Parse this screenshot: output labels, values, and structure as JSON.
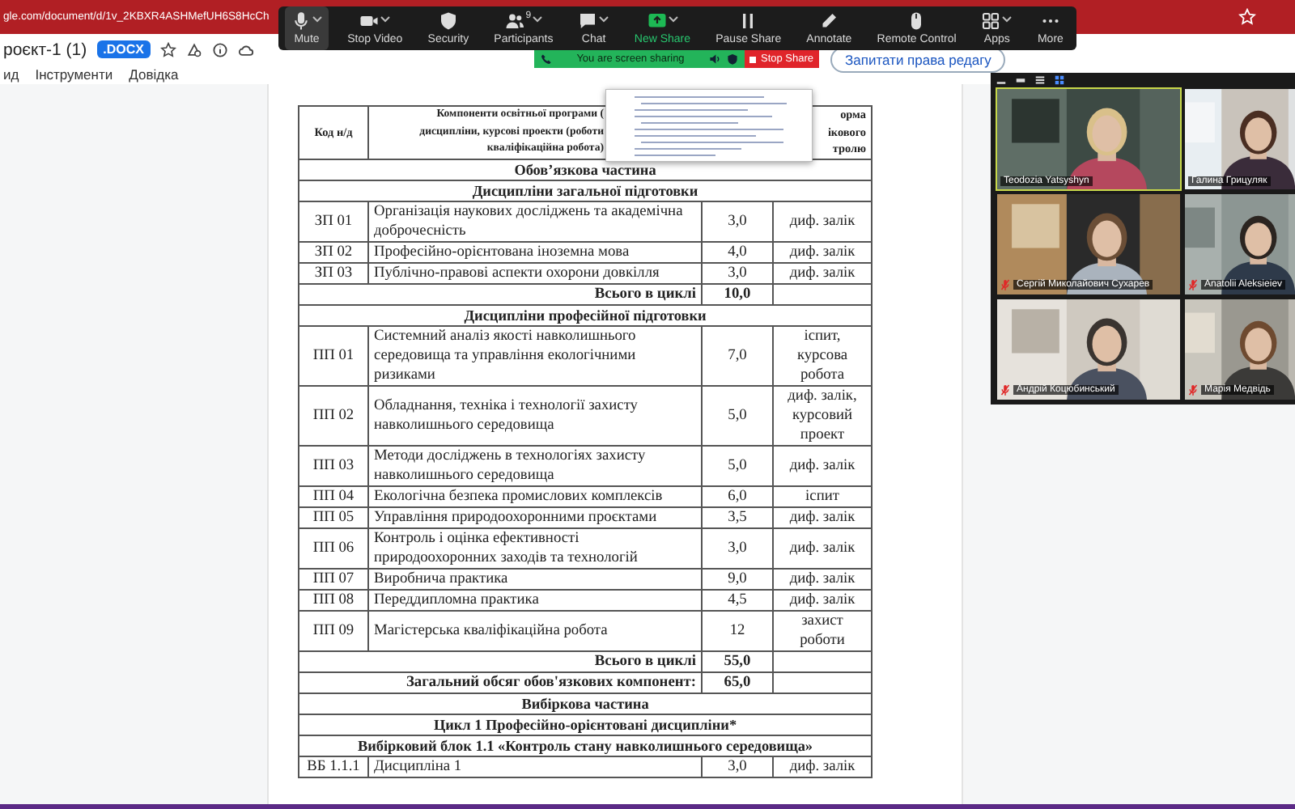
{
  "browser": {
    "url": "gle.com/document/d/1v_2KBXR4ASHMefUH6S8HcCh"
  },
  "document": {
    "title": "роєкт-1 (1)",
    "badge": ".DOCX",
    "menu": [
      "ид",
      "Інструменти",
      "Довідка"
    ],
    "request_button": "Запитати права редагу"
  },
  "meeting_toolbar": {
    "items": [
      {
        "label": "Mute",
        "kind": "mic",
        "caret": true,
        "selected": true,
        "accent": false
      },
      {
        "label": "Stop Video",
        "kind": "camera",
        "caret": true,
        "selected": false,
        "accent": false
      },
      {
        "label": "Security",
        "kind": "shield",
        "caret": false,
        "selected": false,
        "accent": false
      },
      {
        "label": "Participants",
        "kind": "people",
        "caret": true,
        "selected": false,
        "accent": false,
        "count": "9"
      },
      {
        "label": "Chat",
        "kind": "chat",
        "caret": true,
        "selected": false,
        "accent": false
      },
      {
        "label": "New Share",
        "kind": "share",
        "caret": true,
        "selected": false,
        "accent": true
      },
      {
        "label": "Pause Share",
        "kind": "pause",
        "caret": false,
        "selected": false,
        "accent": false
      },
      {
        "label": "Annotate",
        "kind": "pen",
        "caret": false,
        "selected": false,
        "accent": false
      },
      {
        "label": "Remote Control",
        "kind": "mouse",
        "caret": false,
        "selected": false,
        "accent": false
      },
      {
        "label": "Apps",
        "kind": "apps",
        "caret": true,
        "selected": false,
        "accent": false
      },
      {
        "label": "More",
        "kind": "more",
        "caret": false,
        "selected": false,
        "accent": false
      }
    ]
  },
  "sharing_bar": {
    "status": "You are screen sharing",
    "stop_label": "Stop Share"
  },
  "table": {
    "header": {
      "code": "Код н/д",
      "components": [
        "Компоненти освітньої програми (",
        "дисципліни, курсові проекти (роботи",
        "кваліфікаційна робота)"
      ],
      "control": [
        "орма",
        "ікового",
        "тролю"
      ]
    },
    "rows": [
      {
        "kind": "section",
        "text": "Обов’язкова частина"
      },
      {
        "kind": "section",
        "text": "Дисципліни загальної підготовки"
      },
      {
        "kind": "item",
        "code": "ЗП 01",
        "name": "Організація наукових досліджень та академічна доброчесність",
        "credits": "3,0",
        "control": "диф. залік"
      },
      {
        "kind": "item",
        "code": "ЗП 02",
        "name": "Професійно-орієнтована іноземна мова",
        "credits": "4,0",
        "control": "диф. залік"
      },
      {
        "kind": "item",
        "code": "ЗП 03",
        "name": "Публічно-правові аспекти охорони довкілля",
        "credits": "3,0",
        "control": "диф. залік"
      },
      {
        "kind": "total",
        "text": "Всього в циклі",
        "value": "10,0"
      },
      {
        "kind": "section",
        "text": "Дисципліни професійної підготовки"
      },
      {
        "kind": "item",
        "code": "ПП 01",
        "name": "Системний аналіз якості навколишнього середовища та управління екологічними ризиками",
        "credits": "7,0",
        "control": "іспит, курсова робота"
      },
      {
        "kind": "item",
        "code": "ПП 02",
        "name": "Обладнання, техніка і технології захисту навколишнього середовища",
        "credits": "5,0",
        "control": "диф. залік, курсовий проект"
      },
      {
        "kind": "item",
        "code": "ПП 03",
        "name": "Методи досліджень в технологіях захисту навколишнього середовища",
        "credits": "5,0",
        "control": "диф. залік"
      },
      {
        "kind": "item",
        "code": "ПП 04",
        "name": "Екологічна безпека промислових комплексів",
        "credits": "6,0",
        "control": "іспит"
      },
      {
        "kind": "item",
        "code": "ПП 05",
        "name": "Управління природоохоронними проєктами",
        "credits": "3,5",
        "control": "диф. залік"
      },
      {
        "kind": "item",
        "code": "ПП 06",
        "name": "Контроль і оцінка ефективності природоохоронних заходів та технологій",
        "credits": "3,0",
        "control": "диф. залік"
      },
      {
        "kind": "item",
        "code": "ПП 07",
        "name": "Виробнича практика",
        "credits": "9,0",
        "control": "диф. залік"
      },
      {
        "kind": "item",
        "code": "ПП 08",
        "name": "Переддипломна практика",
        "credits": "4,5",
        "control": "диф. залік"
      },
      {
        "kind": "item",
        "code": "ПП 09",
        "name": "Магістерська кваліфікаційна робота",
        "credits": "12",
        "control": "захист роботи"
      },
      {
        "kind": "total",
        "text": "Всього в циклі",
        "value": "55,0"
      },
      {
        "kind": "total",
        "text": "Загальний обсяг обов'язкових компонент:",
        "value": "65,0"
      },
      {
        "kind": "section",
        "text": "Вибіркова частина"
      },
      {
        "kind": "section",
        "text": "Цикл 1 Професійно-орієнтовані дисципліни*"
      },
      {
        "kind": "section",
        "text": "Вибірковий блок 1.1 «Контроль стану навколишнього середовища»"
      },
      {
        "kind": "item",
        "code": "ВБ 1.1.1",
        "name": "Дисципліна 1",
        "credits": "3,0",
        "control": "диф. залік"
      }
    ]
  },
  "video_panel": {
    "tiles": [
      {
        "name": "Teodozia Yatsyshyn",
        "muted": false,
        "speaking": true
      },
      {
        "name": "Галина Грицуляк",
        "muted": false,
        "speaking": false
      },
      {
        "name": "Сергій Миколайович Сухарев",
        "muted": true,
        "speaking": false
      },
      {
        "name": "Anatolii Aleksieiev",
        "muted": true,
        "speaking": false
      },
      {
        "name": "Андрій Коцюбинський",
        "muted": true,
        "speaking": false
      },
      {
        "name": "Марія Медвідь",
        "muted": true,
        "speaking": false
      }
    ]
  }
}
